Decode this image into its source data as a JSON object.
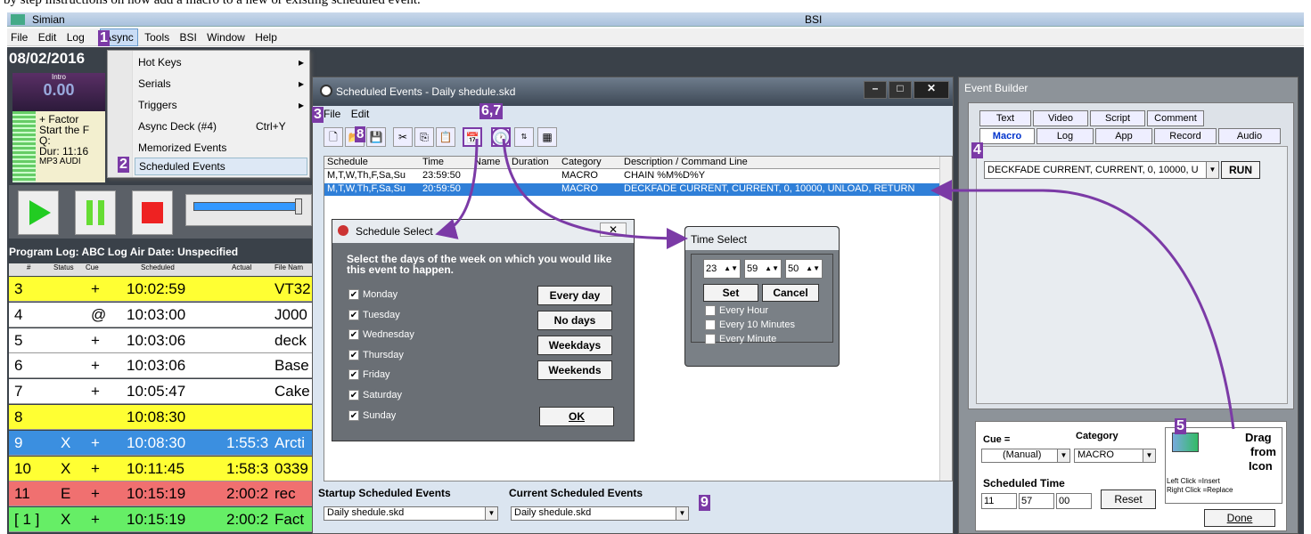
{
  "caption": "by step instructions on how add a macro to a new or existing scheduled event.",
  "app": {
    "title": "Simian",
    "center_title": "BSI"
  },
  "menubar": [
    "File",
    "Edit",
    "Log",
    "Async",
    "Tools",
    "BSI",
    "Window",
    "Help"
  ],
  "date": "08/02/2016",
  "intro": {
    "label": "Intro",
    "value": "0.00"
  },
  "now_playing": {
    "line1": "+ Factor",
    "line2": "Start the F",
    "q": "Q:",
    "dur": "Dur: 11:16",
    "fmt": "MP3  AUDI"
  },
  "async_menu": [
    {
      "label": "Hot Keys",
      "shortcut": "",
      "arrow": "▸"
    },
    {
      "label": "Serials",
      "shortcut": "",
      "arrow": "▸"
    },
    {
      "label": "Triggers",
      "shortcut": "",
      "arrow": "▸"
    },
    {
      "label": "Async Deck (#4)",
      "shortcut": "Ctrl+Y",
      "arrow": ""
    },
    {
      "label": "Memorized Events",
      "shortcut": "",
      "arrow": ""
    },
    {
      "label": "Scheduled Events",
      "shortcut": "",
      "arrow": ""
    }
  ],
  "program_log": {
    "header": "Program Log: ABC Log   Air Date: Unspecified",
    "columns": [
      "#",
      "Status",
      "Cue",
      "Scheduled",
      "Actual",
      "File Nam"
    ],
    "rows": [
      {
        "n": "3",
        "status": "",
        "cue": "+",
        "sched": "10:02:59",
        "actual": "",
        "file": "VT32",
        "bg": "#ffff33",
        "fg": "#000"
      },
      {
        "n": "4",
        "status": "",
        "cue": "@",
        "sched": "10:03:00",
        "actual": "",
        "file": "J000",
        "bg": "#ffffff",
        "fg": "#000"
      },
      {
        "n": "5",
        "status": "",
        "cue": "+",
        "sched": "10:03:06",
        "actual": "",
        "file": "deck",
        "bg": "#ffffff",
        "fg": "#000"
      },
      {
        "n": "6",
        "status": "",
        "cue": "+",
        "sched": "10:03:06",
        "actual": "",
        "file": "Base",
        "bg": "#ffffff",
        "fg": "#000"
      },
      {
        "n": "7",
        "status": "",
        "cue": "+",
        "sched": "10:05:47",
        "actual": "",
        "file": "Cake",
        "bg": "#ffffff",
        "fg": "#000"
      },
      {
        "n": "8",
        "status": "",
        "cue": "",
        "sched": "10:08:30",
        "actual": "",
        "file": "",
        "bg": "#ffff33",
        "fg": "#000"
      },
      {
        "n": "9",
        "status": "X",
        "cue": "+",
        "sched": "10:08:30",
        "actual": "1:55:3",
        "file": "Arcti",
        "bg": "#3b8fe0",
        "fg": "#fff"
      },
      {
        "n": "10",
        "status": "X",
        "cue": "+",
        "sched": "10:11:45",
        "actual": "1:58:3",
        "file": "0339",
        "bg": "#ffff33",
        "fg": "#000"
      },
      {
        "n": "11",
        "status": "E",
        "cue": "+",
        "sched": "10:15:19",
        "actual": "2:00:2",
        "file": "rec",
        "bg": "#f07070",
        "fg": "#000"
      },
      {
        "n": "[ 1 ]",
        "status": "X",
        "cue": "+",
        "sched": "10:15:19",
        "actual": "2:00:2",
        "file": "Fact",
        "bg": "#66ee66",
        "fg": "#000"
      }
    ]
  },
  "scheduled_events": {
    "title": "Scheduled Events - Daily shedule.skd",
    "menu": [
      "File",
      "Edit"
    ],
    "columns": [
      "Schedule",
      "Time",
      "Name",
      "Duration",
      "Category",
      "Description / Command Line"
    ],
    "rows": [
      {
        "schedule": "M,T,W,Th,F,Sa,Su",
        "time": "23:59:50",
        "name": "",
        "duration": "",
        "category": "MACRO",
        "desc": "CHAIN %M%D%Y",
        "selected": false
      },
      {
        "schedule": "M,T,W,Th,F,Sa,Su",
        "time": "20:59:50",
        "name": "",
        "duration": "",
        "category": "MACRO",
        "desc": "DECKFADE CURRENT, CURRENT, 0, 10000, UNLOAD, RETURN",
        "selected": true
      }
    ],
    "startup_label": "Startup Scheduled Events",
    "current_label": "Current Scheduled Events",
    "startup_value": "Daily shedule.skd",
    "current_value": "Daily shedule.skd"
  },
  "schedule_select": {
    "title": "Schedule Select",
    "instructions": "Select the days of the week on which you would like this event to happen.",
    "days": [
      "Monday",
      "Tuesday",
      "Wednesday",
      "Thursday",
      "Friday",
      "Saturday",
      "Sunday"
    ],
    "buttons": [
      "Every day",
      "No days",
      "Weekdays",
      "Weekends"
    ],
    "ok": "OK"
  },
  "time_select": {
    "title": "Time Select",
    "hh": "23",
    "mm": "59",
    "ss": "50",
    "set": "Set",
    "cancel": "Cancel",
    "options": [
      "Every Hour",
      "Every 10 Minutes",
      "Every Minute"
    ]
  },
  "event_builder": {
    "title": "Event Builder",
    "tabs_top": [
      "Text",
      "Video",
      "Script",
      "Comment"
    ],
    "tabs_bottom": [
      "Macro",
      "Log",
      "App",
      "Record",
      "Audio"
    ],
    "macro_value": "DECKFADE CURRENT, CURRENT, 0, 10000, U",
    "run": "RUN",
    "cue_label": "Cue =",
    "category_label": "Category",
    "cue_value": "(Manual)",
    "category_value": "MACRO",
    "sched_time_label": "Scheduled Time",
    "hh": "11",
    "mm": "57",
    "ss": "00",
    "reset": "Reset",
    "drag": [
      "Drag",
      "from",
      "Icon"
    ],
    "left_click": "Left Click  =Insert",
    "right_click": "Right Click =Replace",
    "done": "Done"
  },
  "steps": [
    "1",
    "2",
    "3",
    "4",
    "5",
    "6,7",
    "8",
    "9"
  ],
  "colors": {
    "accent": "#7b3aa6",
    "selection": "#2f7fd8"
  }
}
